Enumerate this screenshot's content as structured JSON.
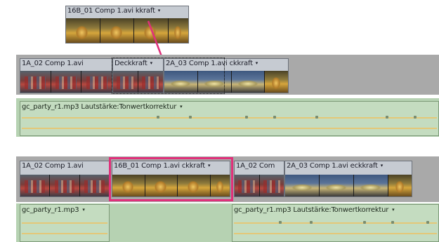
{
  "dragged_clip": {
    "label": "16B_01 Comp 1.avi",
    "suffix": "kkraft",
    "dropdown": "▾"
  },
  "before": {
    "video_clips": [
      {
        "label": "1A_02 Comp 1.avi",
        "suffix": "",
        "dropdown": ""
      },
      {
        "label": "Deckkraft",
        "suffix": "",
        "dropdown": "▾"
      },
      {
        "label": "2A_03 Comp 1.avi",
        "suffix": "ckkraft",
        "dropdown": "▾"
      }
    ],
    "audio_clip": {
      "label": "gc_party_r1.mp3",
      "effect": "Lautstärke:Tonwertkorrektur",
      "dropdown": "▾"
    }
  },
  "after": {
    "video_clips": [
      {
        "label": "1A_02 Comp 1.avi",
        "suffix": "",
        "dropdown": ""
      },
      {
        "label": "16B_01 Comp 1.avi",
        "suffix": "ckkraft",
        "dropdown": "▾"
      },
      {
        "label": "1A_02 Com",
        "suffix": "",
        "dropdown": ""
      },
      {
        "label": "2A_03 Comp 1.avi",
        "suffix": "eckkraft",
        "dropdown": "▾"
      }
    ],
    "audio_clips": [
      {
        "label": "gc_party_r1.mp3",
        "effect": "",
        "dropdown": "▾"
      },
      {
        "label": "gc_party_r1.mp3",
        "effect": "Lautstärke:Tonwertkorrektur",
        "dropdown": "▾"
      }
    ]
  },
  "colors": {
    "highlight": "#e0307a",
    "arrow": "#e0307a",
    "track_bg": "#a9a9a9",
    "audio_track": "#b6d2b2"
  }
}
